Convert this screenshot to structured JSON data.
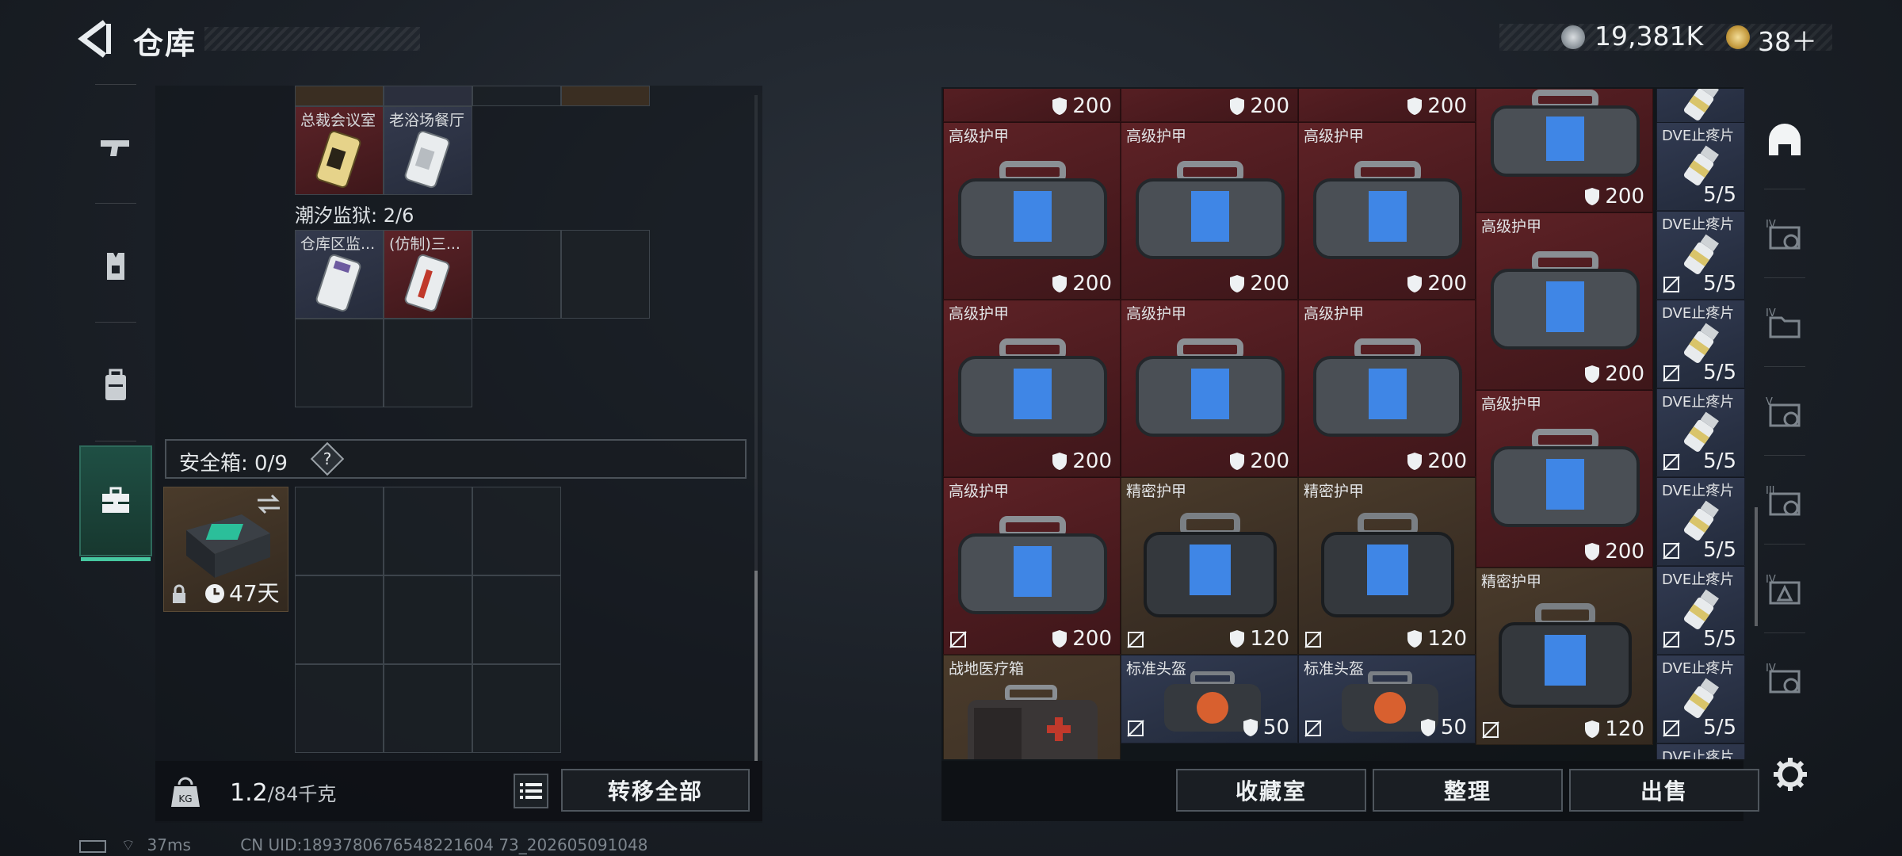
{
  "header": {
    "title": "仓库",
    "currency_main": "19,381K",
    "currency_secondary": "38＋"
  },
  "status": {
    "ping": "37ms",
    "uid": "CN UID:1893780676548221604 73_202605091048"
  },
  "left_nav": [
    "weapon-icon",
    "armor-vest-icon",
    "backpack-icon",
    "toolbox-icon"
  ],
  "storage": {
    "row1": [
      {
        "label": "总裁会议室"
      },
      {
        "label": "老浴场餐厅"
      }
    ],
    "section2_label": "潮汐监狱: 2/6",
    "row2": [
      {
        "label": "仓库区监..."
      },
      {
        "label": "(仿制)三..."
      }
    ],
    "safe_box_label": "安全箱: 0/9",
    "safe_box_help": "?",
    "safe_box_item_days": "47天",
    "weight_value": "1.2",
    "weight_max": "/84千克",
    "transfer_all": "转移全部"
  },
  "inventory": {
    "top_row_durability": [
      "200",
      "200",
      "200",
      "200"
    ],
    "items": [
      {
        "name": "高级护甲",
        "dur": "200"
      },
      {
        "name": "高级护甲",
        "dur": "200"
      },
      {
        "name": "高级护甲",
        "dur": "200"
      },
      {
        "name": "高级护甲",
        "dur": "200"
      },
      {
        "name": "高级护甲",
        "dur": "200"
      },
      {
        "name": "高级护甲",
        "dur": "200"
      },
      {
        "name": "高级护甲",
        "dur": "200"
      },
      {
        "name": "高级护甲",
        "dur": "200"
      },
      {
        "name": "高级护甲",
        "dur": "200"
      },
      {
        "name": "精密护甲",
        "dur": "120"
      },
      {
        "name": "精密护甲",
        "dur": "120"
      },
      {
        "name": "高级护甲",
        "dur": "200"
      },
      {
        "name": "精密护甲",
        "dur": "120"
      },
      {
        "name": "战地医疗箱"
      },
      {
        "name": "标准头盔",
        "dur": "50"
      },
      {
        "name": "标准头盔",
        "dur": "50"
      }
    ],
    "painkiller": {
      "name": "DVE止疼片",
      "count": "5/5"
    },
    "collection_button": "收藏室",
    "organize_button": "整理",
    "sell_button": "出售"
  },
  "right_tabs": [
    "helmet-icon",
    "case-iv-icon",
    "folder-iv-icon",
    "case-v-icon",
    "case-iii-icon",
    "case-iv-b-icon",
    "case-iv-c-icon"
  ],
  "colors": {
    "accent": "#46c7a0",
    "red_rarity": "#4a1a1e",
    "gold_rarity": "#3b2f24",
    "blue_rarity": "#283043"
  }
}
